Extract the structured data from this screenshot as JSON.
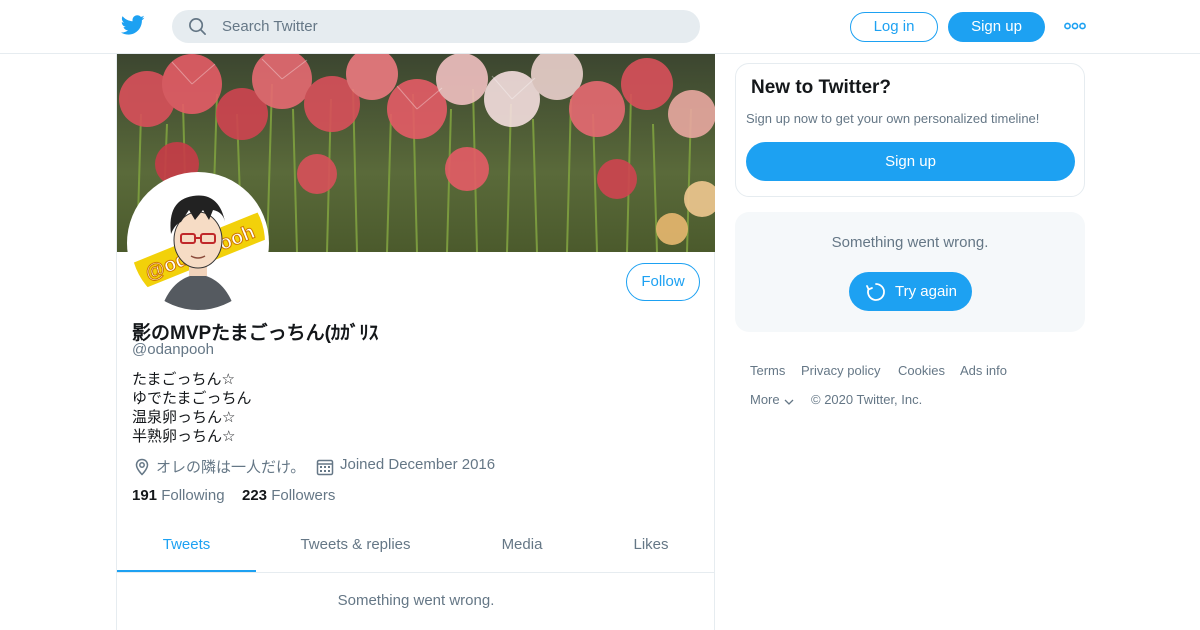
{
  "header": {
    "search_placeholder": "Search Twitter",
    "login_label": "Log in",
    "signup_label": "Sign up",
    "logo_icon": "twitter-bird-icon",
    "more_icon": "more-dots-icon"
  },
  "profile": {
    "display_name": "影のMVPたまごっちん(ｶｶﾞﾘｽ",
    "handle": "@odanpooh",
    "follow_label": "Follow",
    "bio_lines": [
      "たまごっちん☆",
      "ゆでたまごっちん",
      "温泉卵っちん☆",
      "半熟卵っちん☆"
    ],
    "location": "オレの隣は一人だけ。",
    "joined": "Joined December 2016",
    "following_count": "191",
    "following_label": "Following",
    "followers_count": "223",
    "followers_label": "Followers",
    "avatar_text": "@odanpooh"
  },
  "tabs": [
    {
      "label": "Tweets",
      "active": true
    },
    {
      "label": "Tweets & replies",
      "active": false
    },
    {
      "label": "Media",
      "active": false
    },
    {
      "label": "Likes",
      "active": false
    }
  ],
  "main_error": "Something went wrong.",
  "sidebar": {
    "new_title": "New to Twitter?",
    "new_subtitle": "Sign up now to get your own personalized timeline!",
    "signup_label": "Sign up",
    "error_message": "Something went wrong.",
    "retry_label": "Try again"
  },
  "footer": {
    "links": [
      "Terms",
      "Privacy policy",
      "Cookies",
      "Ads info"
    ],
    "more_label": "More",
    "copyright": "© 2020 Twitter, Inc."
  },
  "colors": {
    "accent": "#1da1f2",
    "muted": "#657786",
    "border": "#e6ecf0"
  }
}
